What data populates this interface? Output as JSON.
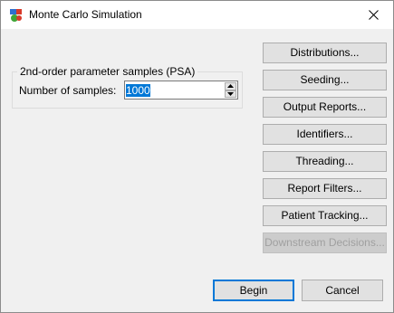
{
  "window": {
    "title": "Monte Carlo Simulation",
    "icon": "app-logo-icon",
    "close_icon": "close-icon"
  },
  "psa_group": {
    "legend": "2nd-order parameter samples (PSA)",
    "samples_label": "Number of samples:",
    "samples_value": "1000"
  },
  "side_buttons": {
    "distributions": "Distributions...",
    "seeding": "Seeding...",
    "output_reports": "Output Reports...",
    "identifiers": "Identifiers...",
    "threading": "Threading...",
    "report_filters": "Report Filters...",
    "patient_tracking": "Patient Tracking...",
    "downstream_decisions": "Downstream Decisions..."
  },
  "footer": {
    "begin": "Begin",
    "cancel": "Cancel"
  },
  "colors": {
    "accent": "#0078d7",
    "dialog_bg": "#f0f0f0",
    "button_bg": "#e1e1e1",
    "disabled_text": "#a0a0a0"
  }
}
